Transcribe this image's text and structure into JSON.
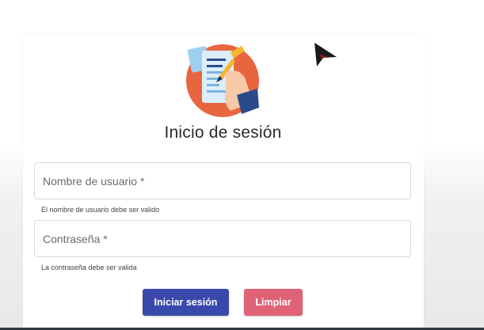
{
  "login": {
    "title": "Inicio de sesión",
    "username": {
      "placeholder": "Nombre de usuario *",
      "value": "",
      "hint": "El nombre de usuario debe ser valido"
    },
    "password": {
      "placeholder": "Contraseña *",
      "value": "",
      "hint": "La contraseña debe ser valida"
    },
    "buttons": {
      "login_label": "Iniciar sesión",
      "clear_label": "Limpiar"
    },
    "logo_icon": "document-signing-icon",
    "cursor_icon": "mouse-pointer-icon"
  },
  "colors": {
    "primary_button": "#3949ab",
    "clear_button": "#e06277",
    "logo_circle": "#e8663f",
    "title_text": "#2b2b2b"
  }
}
